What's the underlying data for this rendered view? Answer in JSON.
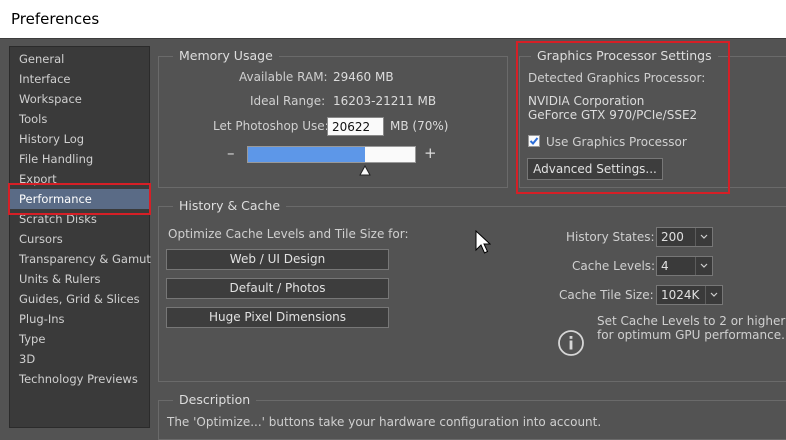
{
  "window": {
    "title": "Preferences"
  },
  "sidebar": {
    "items": [
      {
        "label": "General"
      },
      {
        "label": "Interface"
      },
      {
        "label": "Workspace"
      },
      {
        "label": "Tools"
      },
      {
        "label": "History Log"
      },
      {
        "label": "File Handling"
      },
      {
        "label": "Export"
      },
      {
        "label": "Performance",
        "selected": true
      },
      {
        "label": "Scratch Disks"
      },
      {
        "label": "Cursors"
      },
      {
        "label": "Transparency & Gamut"
      },
      {
        "label": "Units & Rulers"
      },
      {
        "label": "Guides, Grid & Slices"
      },
      {
        "label": "Plug-Ins"
      },
      {
        "label": "Type"
      },
      {
        "label": "3D"
      },
      {
        "label": "Technology Previews"
      }
    ]
  },
  "memory": {
    "title": "Memory Usage",
    "available_label": "Available RAM:",
    "available_value": "29460 MB",
    "ideal_label": "Ideal Range:",
    "ideal_value": "16203-21211 MB",
    "let_label": "Let Photoshop Use:",
    "let_value": "20622",
    "let_suffix": "MB (70%)",
    "slider_minus": "–",
    "slider_plus": "+",
    "slider_fraction": 0.7
  },
  "gpu": {
    "title": "Graphics Processor Settings",
    "detected_label": "Detected Graphics Processor:",
    "vendor": "NVIDIA Corporation",
    "model": "GeForce GTX 970/PCIe/SSE2",
    "use_label": "Use Graphics Processor",
    "use_checked": true,
    "advanced_button": "Advanced Settings..."
  },
  "history": {
    "title": "History & Cache",
    "optimize_label": "Optimize Cache Levels and Tile Size for:",
    "buttons": [
      "Web / UI Design",
      "Default / Photos",
      "Huge Pixel Dimensions"
    ],
    "states_label": "History States:",
    "states_value": "200",
    "levels_label": "Cache Levels:",
    "levels_value": "4",
    "tile_label": "Cache Tile Size:",
    "tile_value": "1024K",
    "info_text_1": "Set Cache Levels to 2 or higher",
    "info_text_2": "for optimum GPU performance."
  },
  "description": {
    "title": "Description",
    "text": "The 'Optimize...' buttons take your hardware configuration into account."
  },
  "colors": {
    "highlight": "#d61f26",
    "selected": "#5a6b86",
    "slider_fill": "#5d97e8"
  }
}
